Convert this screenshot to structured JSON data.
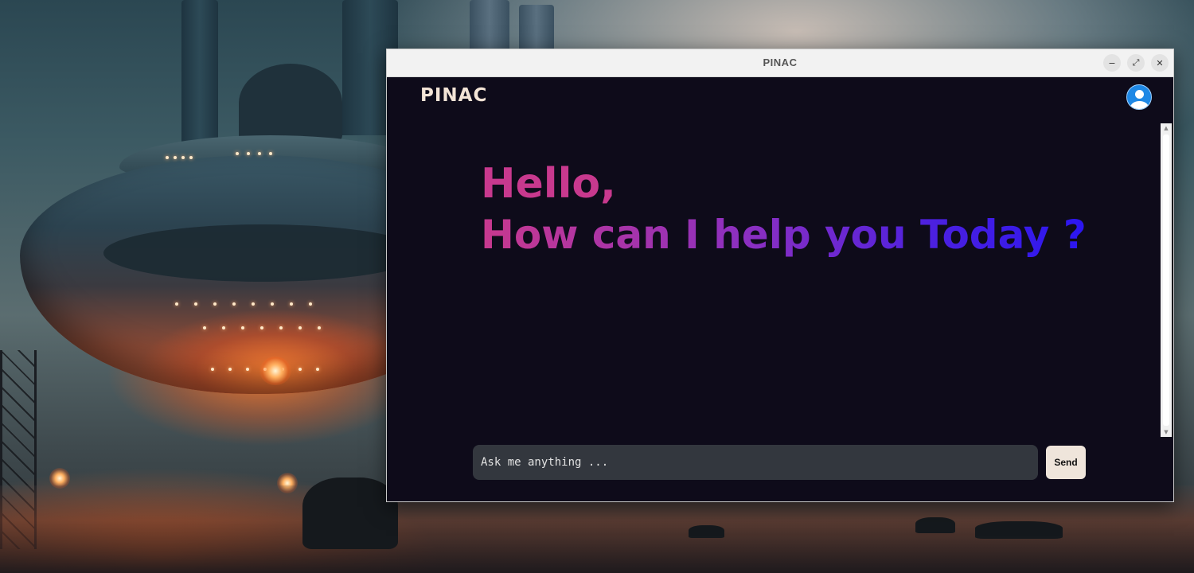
{
  "window": {
    "title": "PINAC",
    "controls": {
      "minimize_icon": "−",
      "maximize_icon": "⤢",
      "close_icon": "✕"
    }
  },
  "header": {
    "logo_text": "PINAC",
    "avatar_icon": "user-avatar-icon"
  },
  "greeting": {
    "line1": "Hello,",
    "line2": "How can I help you Today ?"
  },
  "composer": {
    "placeholder": "Ask me anything ...",
    "value": "",
    "send_label": "Send"
  },
  "colors": {
    "app_background": "#0e0b1a",
    "greeting_start": "#c8398e",
    "greeting_end": "#2b16f0",
    "input_background": "#33373e",
    "send_background": "#efe5db",
    "logo": "#f3e4d6",
    "avatar": "#1e88e5"
  }
}
